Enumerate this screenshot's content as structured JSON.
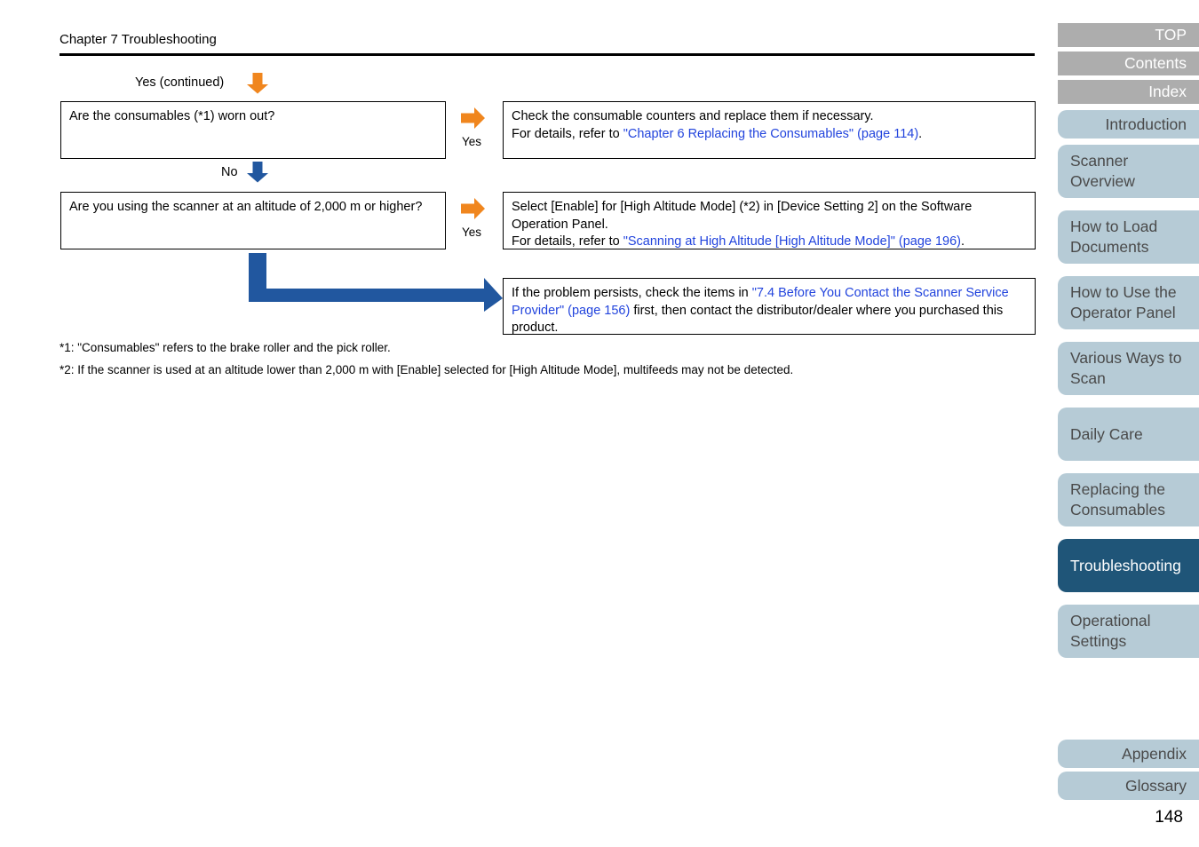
{
  "header": {
    "chapter_title": "Chapter 7 Troubleshooting"
  },
  "flowchart": {
    "entry_label": "Yes (continued)",
    "entry_arrow_icon": "arrow-down-orange-icon",
    "no_label": "No",
    "no_arrow_icon": "arrow-down-blue-icon",
    "elbow_arrow_icon": "arrow-elbow-blue-icon",
    "branches": [
      {
        "question": "Are the consumables (*1) worn out?",
        "yes_tag": "Yes",
        "yes_arrow_icon": "arrow-right-orange-icon",
        "answer_line1": "Check the consumable counters and replace them if necessary.",
        "answer_line2_pre": "For details, refer to ",
        "answer_line2_link": "\"Chapter 6 Replacing the Consumables\" (page 114)",
        "answer_line2_post": "."
      },
      {
        "question": "Are you using the scanner at an altitude of 2,000 m or higher?",
        "yes_tag": "Yes",
        "yes_arrow_icon": "arrow-right-orange-icon",
        "answer_line1": "Select [Enable] for [High Altitude Mode] (*2) in [Device Setting 2] on the Software Operation Panel.",
        "answer_line2_pre": "For details, refer to ",
        "answer_line2_link": "\"Scanning at High Altitude [High Altitude Mode]\" (page 196)",
        "answer_line2_post": "."
      }
    ],
    "final_box": {
      "pre": "If the problem persists, check the items in ",
      "link": "\"7.4 Before You Contact the Scanner Service Provider\" (page 156)",
      "post": " first, then contact the distributor/dealer where you purchased this product."
    }
  },
  "footnotes": [
    "*1: \"Consumables\" refers to the brake roller and the pick roller.",
    "*2: If the scanner is used at an altitude lower than 2,000 m with [Enable] selected for [High Altitude Mode], multifeeds may not be detected."
  ],
  "sidebar": {
    "items": [
      {
        "label": "TOP",
        "style": "gray",
        "align": "right"
      },
      {
        "label": "Contents",
        "style": "gray",
        "align": "right"
      },
      {
        "label": "Index",
        "style": "gray",
        "align": "right"
      },
      {
        "label": "Introduction",
        "style": "blue",
        "align": "right"
      },
      {
        "label": "Scanner Overview",
        "style": "blue",
        "align": "left"
      },
      {
        "label": "How to Load Documents",
        "style": "blue",
        "align": "left"
      },
      {
        "label": "How to Use the Operator Panel",
        "style": "blue",
        "align": "left"
      },
      {
        "label": "Various Ways to Scan",
        "style": "blue",
        "align": "left"
      },
      {
        "label": "Daily Care",
        "style": "blue",
        "align": "left"
      },
      {
        "label": "Replacing the Consumables",
        "style": "blue",
        "align": "left"
      },
      {
        "label": "Troubleshooting",
        "style": "active",
        "align": "left"
      },
      {
        "label": "Operational Settings",
        "style": "blue",
        "align": "left"
      },
      {
        "label": "Appendix",
        "style": "blue",
        "align": "right"
      },
      {
        "label": "Glossary",
        "style": "blue",
        "align": "right"
      }
    ]
  },
  "page_number": "148",
  "colors": {
    "orange": "#f0861e",
    "blue_arrow": "#21579f",
    "link": "#2244dd",
    "nav_gray": "#adadad",
    "nav_blue": "#b6cbd6",
    "nav_active": "#1f5578"
  }
}
